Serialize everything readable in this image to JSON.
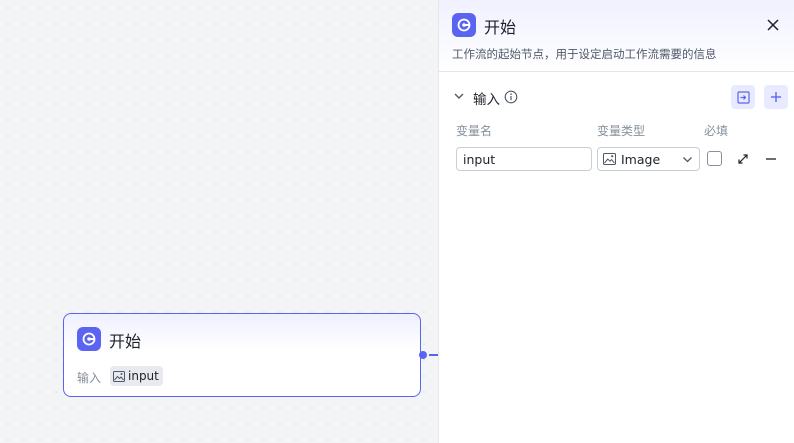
{
  "node": {
    "title": "开始",
    "input_label": "输入",
    "variables": [
      {
        "name": "input",
        "type_icon": "image-icon"
      }
    ]
  },
  "panel": {
    "title": "开始",
    "description": "工作流的起始节点，用于设定启动工作流需要的信息",
    "section": {
      "title": "输入",
      "expanded": true,
      "columns": {
        "name": "变量名",
        "type": "变量类型",
        "required": "必填"
      },
      "rows": [
        {
          "name": "input",
          "type": "Image",
          "required": false
        }
      ]
    }
  },
  "colors": {
    "accent": "#5b63f1",
    "accent_light": "#e8ebff",
    "text_primary": "#1d2129",
    "text_secondary": "#86909c",
    "border": "#c9cdd4"
  }
}
